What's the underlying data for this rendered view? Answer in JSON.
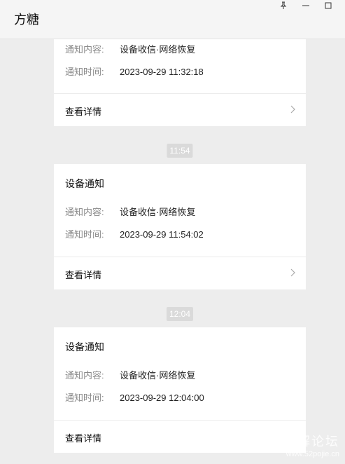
{
  "app": {
    "title": "方糖"
  },
  "window_controls": [
    "pin-icon",
    "minimize-icon",
    "maximize-icon"
  ],
  "labels": {
    "content": "通知内容:",
    "time": "通知时间:",
    "details": "查看详情"
  },
  "messages": [
    {
      "title": "",
      "content": "设备收信·网络恢复",
      "time": "2023-09-29 11:32:18",
      "details": "查看详情"
    },
    {
      "time_marker": "11:54",
      "title": "设备通知",
      "content": "设备收信·网络恢复",
      "time": "2023-09-29 11:54:02",
      "details": "查看详情"
    },
    {
      "time_marker": "12:04",
      "title": "设备通知",
      "content": "设备收信·网络恢复",
      "time": "2023-09-29 12:04:00",
      "details": "查看详情"
    }
  ],
  "watermark": {
    "line1": "吾爱破解论坛",
    "line2": "www.52pojie.cn"
  },
  "colors": {
    "background": "#ededed",
    "card": "#ffffff",
    "label": "#888888",
    "time_marker_bg": "#dadada"
  }
}
